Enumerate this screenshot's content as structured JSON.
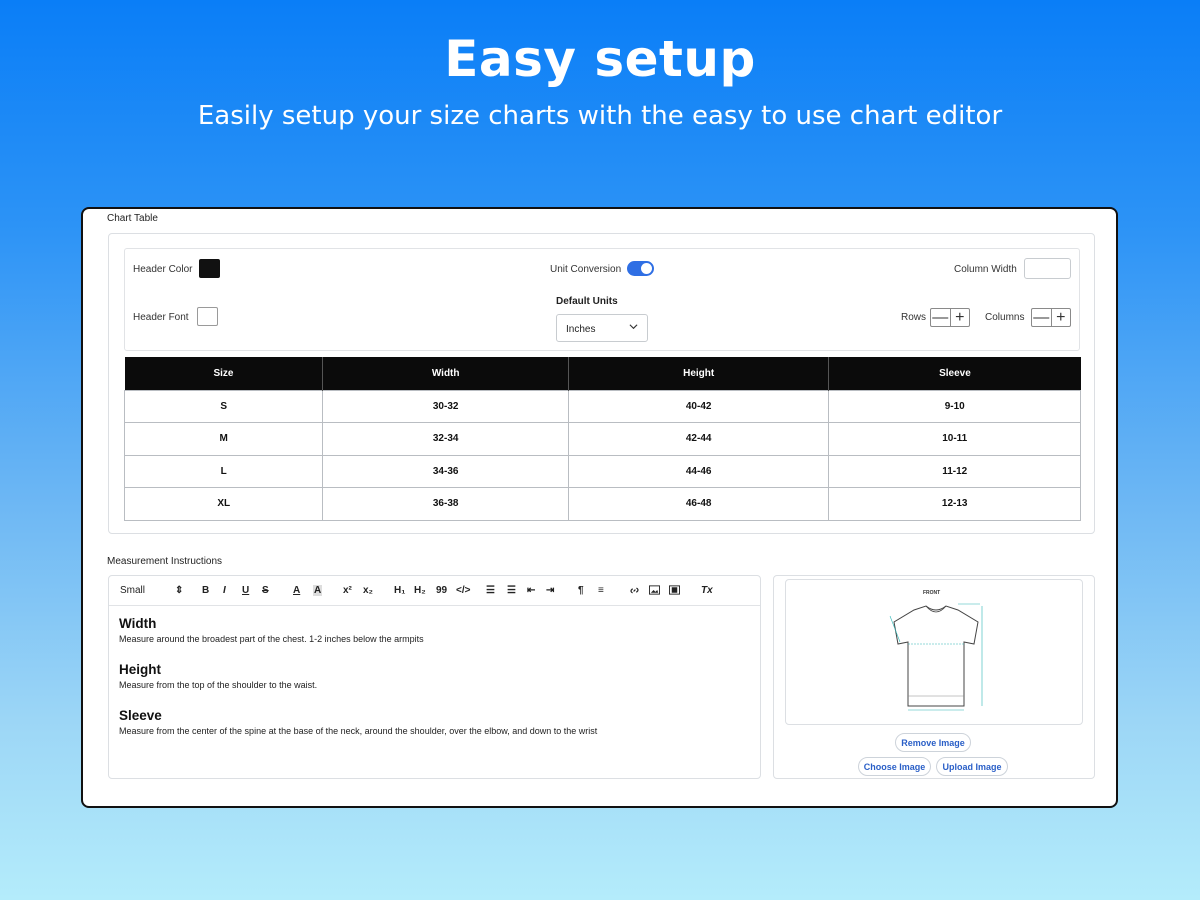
{
  "hero": {
    "title": "Easy setup",
    "subtitle": "Easily  setup your size charts with the easy to use chart editor"
  },
  "chart_table": {
    "section_label": "Chart Table",
    "header_color_label": "Header Color",
    "header_color_value": "#111111",
    "header_font_label": "Header Font",
    "header_font_value": "#ffffff",
    "unit_conversion_label": "Unit Conversion",
    "unit_conversion_on": true,
    "default_units_label": "Default Units",
    "default_units_value": "Inches",
    "column_width_label": "Column Width",
    "column_width_value": "",
    "rows_label": "Rows",
    "columns_label": "Columns",
    "minus_glyph": "—",
    "plus_glyph": "+",
    "headers": [
      "Size",
      "Width",
      "Height",
      "Sleeve"
    ],
    "rows": [
      [
        "S",
        "30-32",
        "40-42",
        "9-10"
      ],
      [
        "M",
        "32-34",
        "42-44",
        "10-11"
      ],
      [
        "L",
        "34-36",
        "44-46",
        "11-12"
      ],
      [
        "XL",
        "36-38",
        "46-48",
        "12-13"
      ]
    ]
  },
  "instructions": {
    "section_label": "Measurement Instructions",
    "toolbar": {
      "font_size": "Small",
      "bold": "B",
      "italic": "I",
      "underline": "U",
      "strike": "S",
      "text_color": "A",
      "highlight": "A",
      "superscript": "x²",
      "subscript": "x₂",
      "h1": "H₁",
      "h2": "H₂",
      "quote": "99",
      "code": "</>",
      "clean": "Tx"
    },
    "blocks": [
      {
        "heading": "Width",
        "text": "Measure around the broadest part of the chest. 1-2 inches below the armpits"
      },
      {
        "heading": "Height",
        "text": "Measure from the top of the shoulder to the waist."
      },
      {
        "heading": "Sleeve",
        "text": "Measure from the center of the spine at the base of the neck, around the shoulder, over the elbow, and down to the wrist"
      }
    ]
  },
  "image_panel": {
    "diagram_label": "FRONT",
    "remove_label": "Remove Image",
    "choose_label": "Choose Image",
    "upload_label": "Upload Image"
  },
  "colors": {
    "accent": "#2f6fe4",
    "table_header_bg": "#0b0b0b",
    "link_blue": "#2a5fc7"
  }
}
